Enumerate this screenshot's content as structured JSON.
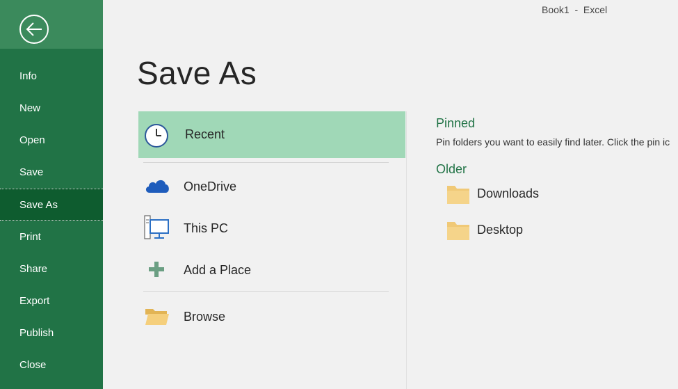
{
  "window": {
    "title": "Book1  -  Excel"
  },
  "sidebar": {
    "back_icon": "back-arrow-icon",
    "items": [
      {
        "label": "Info"
      },
      {
        "label": "New"
      },
      {
        "label": "Open"
      },
      {
        "label": "Save"
      },
      {
        "label": "Save As",
        "active": true
      },
      {
        "label": "Print"
      },
      {
        "label": "Share"
      },
      {
        "label": "Export"
      },
      {
        "label": "Publish"
      },
      {
        "label": "Close"
      }
    ]
  },
  "page": {
    "title": "Save As"
  },
  "locations": {
    "items": [
      {
        "label": "Recent",
        "icon": "clock-icon",
        "selected": true
      },
      {
        "label": "OneDrive",
        "icon": "cloud-icon"
      },
      {
        "label": "This PC",
        "icon": "computer-icon"
      },
      {
        "label": "Add a Place",
        "icon": "plus-icon"
      },
      {
        "label": "Browse",
        "icon": "open-folder-icon"
      }
    ]
  },
  "pinned": {
    "heading": "Pinned",
    "description": "Pin folders you want to easily find later. Click the pin ic"
  },
  "older": {
    "heading": "Older",
    "folders": [
      {
        "label": "Downloads",
        "icon": "folder-icon"
      },
      {
        "label": "Desktop",
        "icon": "folder-icon"
      }
    ]
  },
  "colors": {
    "sidebar_bg": "#217346",
    "sidebar_active": "#0e5c2f",
    "selected_location": "#a0d8b7",
    "accent_text": "#217346",
    "folder": "#f0c977"
  }
}
